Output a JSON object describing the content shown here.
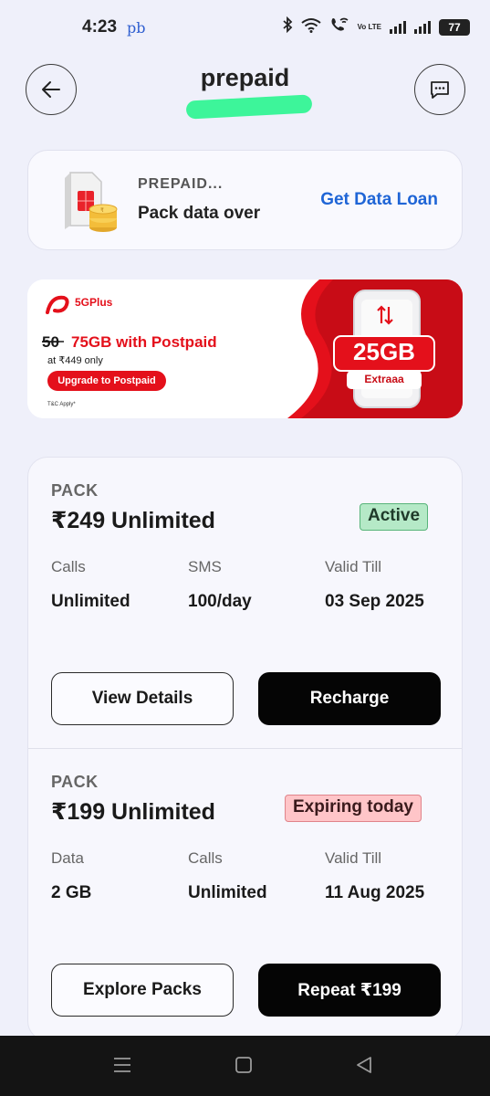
{
  "status_bar": {
    "time": "4:23",
    "carrier": "pb",
    "volte_text": "Vo LTE",
    "battery": "77",
    "icons": [
      "bluetooth-icon",
      "wifi-icon",
      "wifi-calling-icon",
      "volte-icon",
      "signal-icon",
      "signal-icon",
      "battery-icon"
    ]
  },
  "header": {
    "title": "prepaid",
    "back_icon": "arrow-left-icon",
    "chat_icon": "chat-icon",
    "highlight_color": "#3df59a"
  },
  "loan_card": {
    "title": "PREPAID...",
    "subtitle": "Pack data over",
    "link": "Get Data Loan",
    "link_color": "#1f65d6"
  },
  "banner": {
    "brand": "5GPlus",
    "old_data": "50",
    "offer": "75GB with Postpaid",
    "price": "at ₹449 only",
    "cta": "Upgrade to Postpaid",
    "tnc": "T&C Apply*",
    "extra_data": "25GB",
    "extra_label": "Extraaa",
    "accent_color": "#e4101b"
  },
  "packs": [
    {
      "label": "PACK",
      "name": "₹249 Unlimited",
      "status": "Active",
      "details": [
        {
          "heading": "Calls",
          "value": "Unlimited"
        },
        {
          "heading": "SMS",
          "value": "100/day"
        },
        {
          "heading": "Valid Till",
          "value": "03 Sep 2025"
        }
      ],
      "secondary_action": "View Details",
      "primary_action": "Recharge"
    },
    {
      "label": "PACK",
      "name": "₹199 Unlimited",
      "status": "Expiring today",
      "details": [
        {
          "heading": "Data",
          "value": "2 GB"
        },
        {
          "heading": "Calls",
          "value": "Unlimited"
        },
        {
          "heading": "Valid Till",
          "value": "11 Aug 2025"
        }
      ],
      "secondary_action": "Explore Packs",
      "primary_action": "Repeat ₹199"
    }
  ],
  "nav_bar": {
    "icons": [
      "menu-icon",
      "home-icon",
      "back-icon"
    ]
  }
}
